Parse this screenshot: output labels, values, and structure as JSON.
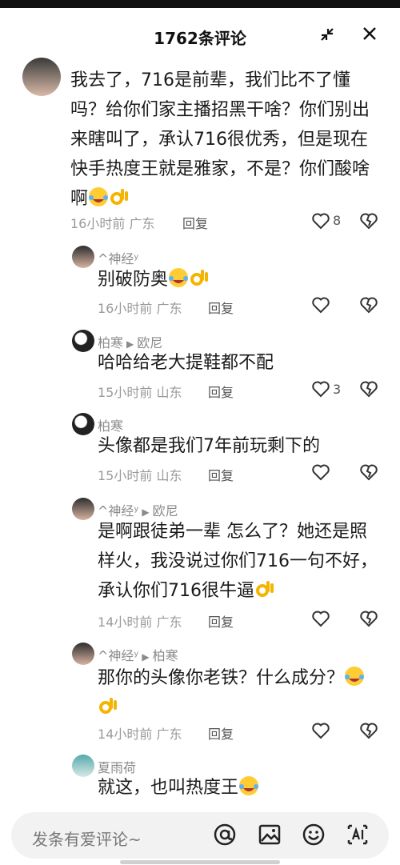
{
  "header": {
    "title": "1762条评论"
  },
  "comments": [
    {
      "name": "",
      "text": "我去了，716是前辈，我们比不了懂吗？给你们家主播招黑干啥？你们别出来瞎叫了，承认716很优秀，但是现在快手热度王就是雅家，不是？你们酸啥啊",
      "time": "16小时前",
      "location": "广东",
      "reply_label": "回复",
      "likes": "8"
    },
    {
      "name": "^神经ʸ",
      "text": "别破防奥",
      "time": "16小时前",
      "location": "广东",
      "reply_label": "回复",
      "likes": ""
    },
    {
      "name": "柏寒",
      "reply_to": "欧尼",
      "text": "哈哈给老大提鞋都不配",
      "time": "15小时前",
      "location": "山东",
      "reply_label": "回复",
      "likes": "3"
    },
    {
      "name": "柏寒",
      "text": "头像都是我们7年前玩剩下的",
      "time": "15小时前",
      "location": "山东",
      "reply_label": "回复",
      "likes": ""
    },
    {
      "name": "^神经ʸ",
      "reply_to": "欧尼",
      "text": "是啊跟徒弟一辈 怎么了？她还是照样火，我没说过你们716一句不好，承认你们716很牛逼",
      "time": "14小时前",
      "location": "广东",
      "reply_label": "回复",
      "likes": ""
    },
    {
      "name": "^神经ʸ",
      "reply_to": "柏寒",
      "text": "那你的头像你老铁？什么成分？",
      "time": "14小时前",
      "location": "广东",
      "reply_label": "回复",
      "likes": ""
    },
    {
      "name": "夏雨荷",
      "text": "就这，也叫热度王",
      "time": "",
      "location": "",
      "reply_label": "",
      "likes": ""
    }
  ],
  "input": {
    "placeholder": "发条有爱评论~"
  }
}
